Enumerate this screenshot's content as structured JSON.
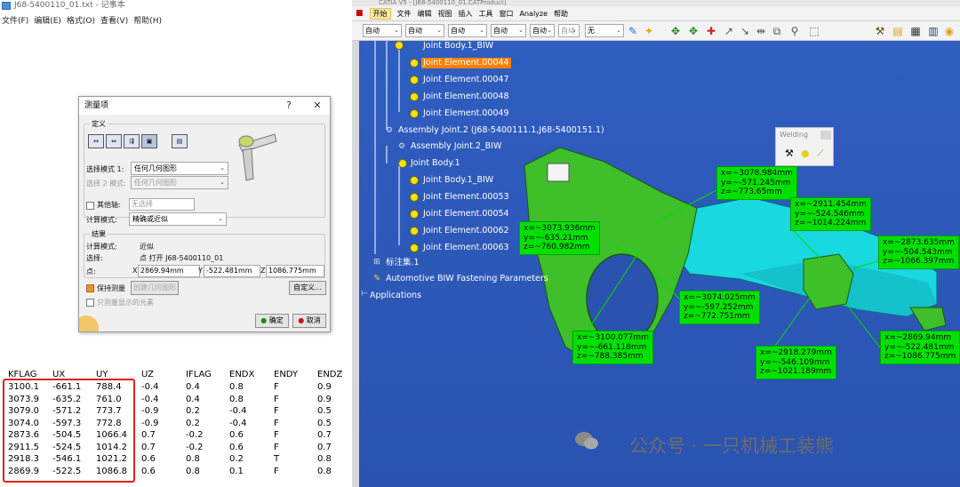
{
  "notepad": {
    "title": "J68-5400110_01.txt - 记事本",
    "menu": [
      "文件(F)",
      "编辑(E)",
      "格式(O)",
      "查看(V)",
      "帮助(H)"
    ],
    "table": {
      "headers": [
        "KFLAG",
        "UX",
        "UY",
        "UZ",
        "IFLAG",
        "ENDX",
        "ENDY",
        "ENDZ"
      ],
      "rows": [
        [
          "3100.1",
          "-661.1",
          "788.4",
          "-0.4",
          "0.4",
          "0.8",
          "F",
          "0.9"
        ],
        [
          "3073.9",
          "-635.2",
          "761.0",
          "-0.4",
          "0.4",
          "0.8",
          "F",
          "0.9"
        ],
        [
          "3079.0",
          "-571.2",
          "773.7",
          "-0.9",
          "0.2",
          "-0.4",
          "F",
          "0.5"
        ],
        [
          "3074.0",
          "-597.3",
          "772.8",
          "-0.9",
          "0.2",
          "-0.4",
          "F",
          "0.5"
        ],
        [
          "2873.6",
          "-504.5",
          "1066.4",
          "0.7",
          "-0.2",
          "0.6",
          "F",
          "0.7"
        ],
        [
          "2911.5",
          "-524.5",
          "1014.2",
          "0.7",
          "-0.2",
          "0.6",
          "F",
          "0.7"
        ],
        [
          "2918.3",
          "-546.1",
          "1021.2",
          "0.6",
          "0.8",
          "0.2",
          "T",
          "0.8"
        ],
        [
          "2869.9",
          "-522.5",
          "1086.8",
          "0.6",
          "0.8",
          "0.1",
          "F",
          "0.8"
        ]
      ]
    }
  },
  "measure_dialog": {
    "title": "测量项",
    "help": "?",
    "close": "✕",
    "define_legend": "定义",
    "mode1_label": "选择模式 1:",
    "mode1_value": "任何几何图形",
    "mode2_label": "选择 2 模式:",
    "mode2_value": "任何几何图形",
    "other_axis_label": "其他轴:",
    "other_axis_value": "无选择",
    "calc_mode_label": "计算模式:",
    "calc_mode_value": "精确或近似",
    "result_legend": "结果",
    "calc_mode_result_label": "计算模式:",
    "calc_mode_result_value": "近似",
    "selection_label": "选择:",
    "selection_value": "点 打开 J68-5400110_01",
    "point_label": "点:",
    "x_label": "X",
    "x_value": "2869.94mm",
    "y_label": "Y",
    "y_value": "-522.481mm",
    "z_label": "Z",
    "z_value": "1086.775mm",
    "keep_measure_label": "保持测量",
    "create_geometry_label": "创建几何图形",
    "customize_label": "自定义...",
    "only_visible_label": "只测量显示的元素",
    "ok_label": "确定",
    "cancel_label": "取消"
  },
  "catia": {
    "title": "CATIA V5 - [J68-5400110_01.CATProduct]",
    "menu": [
      "开始",
      "文件",
      "编辑",
      "视图",
      "插入",
      "工具",
      "窗口",
      "Analyze",
      "帮助"
    ],
    "toolbar_dropdowns": [
      "自动",
      "自动",
      "自动",
      "自动",
      "自动",
      "自动",
      "无"
    ],
    "tree": {
      "joint_body_1_top": "Joint Body.1_BIW",
      "joint_element_44": "Joint Element.00044",
      "joint_element_47": "Joint Element.00047",
      "joint_element_48": "Joint Element.00048",
      "joint_element_49": "Joint Element.00049",
      "assembly_joint_2": "Assembly Joint.2 (J68-5400111.1,J68-5400151.1)",
      "assembly_joint_2_biw": "Assembly Joint.2_BIW",
      "joint_body_1": "Joint Body.1",
      "joint_body_1_biw": "Joint Body.1_BIW",
      "joint_element_53": "Joint Element.00053",
      "joint_element_54": "Joint Element.00054",
      "joint_element_62": "Joint Element.00062",
      "joint_element_63": "Joint Element.00063",
      "annotation_set": "标注集.1",
      "fastening_params": "Automotive BIW Fastening Parameters",
      "applications": "Applications"
    },
    "welding_toolbar_title": "Welding",
    "callouts": [
      {
        "x": "x=~3078.984mm",
        "y": "y=~-571.245mm",
        "z": "z=~773.65mm"
      },
      {
        "x": "x=~2911.454mm",
        "y": "y=~-524.546mm",
        "z": "z=~1014.224mm"
      },
      {
        "x": "x=~3073.936mm",
        "y": "y=~-635.21mm",
        "z": "z=~760.982mm"
      },
      {
        "x": "x=~2873.635mm",
        "y": "y=~-504.543mm",
        "z": "z=~1066.397mm"
      },
      {
        "x": "x=~3074.025mm",
        "y": "y=~-597.252mm",
        "z": "z=~772.751mm"
      },
      {
        "x": "x=~3100.077mm",
        "y": "y=~-661.118mm",
        "z": "z=~788.385mm"
      },
      {
        "x": "x=~2918.279mm",
        "y": "y=~-546.109mm",
        "z": "z=~1021.189mm"
      },
      {
        "x": "x=~2869.94mm",
        "y": "y=~-522.481mm",
        "z": "z=~1086.775mm"
      }
    ]
  },
  "watermark": "公众号 · 一只机械工装熊",
  "colors": {
    "catia_background": "#2b56b5",
    "callout_green": "#00e000",
    "highlight_orange": "#ff7f00",
    "table_box_red": "#e02020",
    "part_green": "#3fbf2a",
    "part_cyan": "#18d8e0"
  }
}
